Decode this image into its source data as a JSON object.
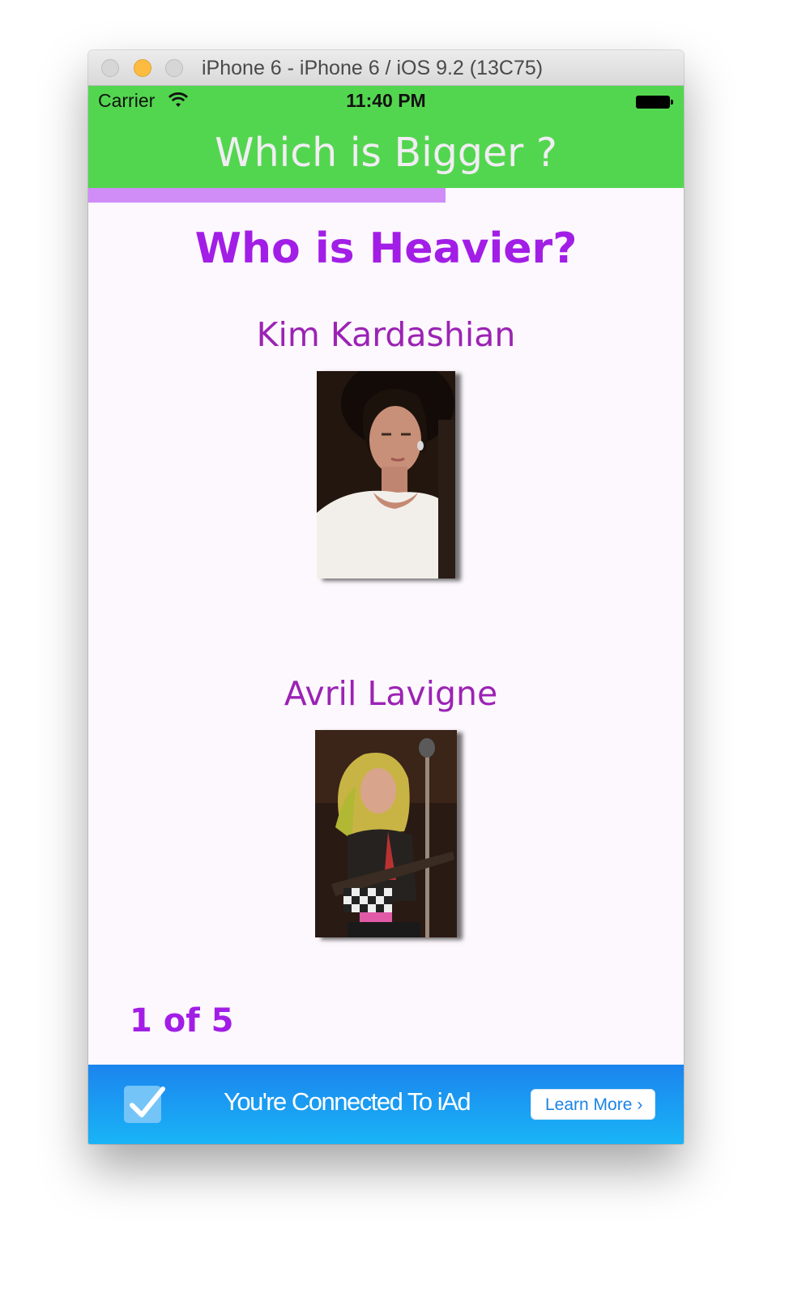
{
  "window": {
    "title": "iPhone 6 - iPhone 6 / iOS 9.2 (13C75)"
  },
  "status_bar": {
    "carrier": "Carrier",
    "time": "11:40 PM"
  },
  "nav": {
    "title": "Which is Bigger ?"
  },
  "progress": {
    "fraction": 0.6
  },
  "quiz": {
    "question": "Who is Heavier?",
    "options": [
      {
        "name": "Kim Kardashian",
        "image": "kim-kardashian-photo"
      },
      {
        "name": "Avril Lavigne",
        "image": "avril-lavigne-photo"
      }
    ],
    "counter": "1 of 5"
  },
  "ad": {
    "text": "You're Connected To iAd",
    "button_label": "Learn More",
    "chevron": "›"
  },
  "colors": {
    "nav_green": "#53d64f",
    "accent_purple": "#a21ee6",
    "name_purple": "#9b23b4",
    "progress_purple": "#d08df8",
    "ad_blue": "#1b84ee"
  }
}
